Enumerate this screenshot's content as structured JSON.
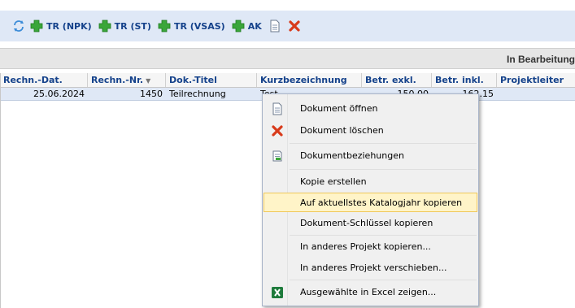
{
  "toolbar": {
    "items": [
      {
        "label": "TR (NPK)",
        "icon": "plus-icon"
      },
      {
        "label": "TR (ST)",
        "icon": "plus-icon"
      },
      {
        "label": "TR (VSAS)",
        "icon": "plus-icon"
      },
      {
        "label": "AK",
        "icon": "plus-icon"
      }
    ],
    "icons": [
      "refresh-icon",
      "document-icon",
      "delete-icon"
    ],
    "colors": {
      "plus": "#2f9b2f",
      "delete": "#d83a1a",
      "background": "#dfe8f6"
    }
  },
  "status": {
    "text": "In Bearbeitung"
  },
  "table": {
    "columns": [
      "Rechn.-Dat.",
      "Rechn.-Nr.",
      "Dok.-Titel",
      "Kurzbezeichnung",
      "Betr. exkl.",
      "Betr. inkl.",
      "Projektleiter"
    ],
    "sort_indicator": "▼",
    "rows": [
      {
        "date": "25.06.2024",
        "number": "1450",
        "title": "Teilrechnung",
        "short": "Test",
        "excl": "150.00",
        "incl": "162.15",
        "manager": ""
      }
    ]
  },
  "context_menu": {
    "items": [
      {
        "label": "Dokument öffnen",
        "icon": "document-icon"
      },
      {
        "label": "Dokument löschen",
        "icon": "delete-icon"
      },
      {
        "label": "Dokumentbeziehungen",
        "icon": "document-relations-icon"
      },
      {
        "label": "Kopie erstellen",
        "icon": ""
      },
      {
        "label": "Auf aktuellstes Katalogjahr kopieren",
        "icon": ""
      },
      {
        "label": "Dokument-Schlüssel kopieren",
        "icon": ""
      },
      {
        "label": "In anderes Projekt kopieren...",
        "icon": ""
      },
      {
        "label": "In anderes Projekt verschieben...",
        "icon": ""
      },
      {
        "label": "Ausgewählte in Excel zeigen...",
        "icon": "excel-icon"
      }
    ],
    "highlighted": "Auf aktuellstes Katalogjahr kopieren",
    "highlight_color": "#fff4c8"
  }
}
